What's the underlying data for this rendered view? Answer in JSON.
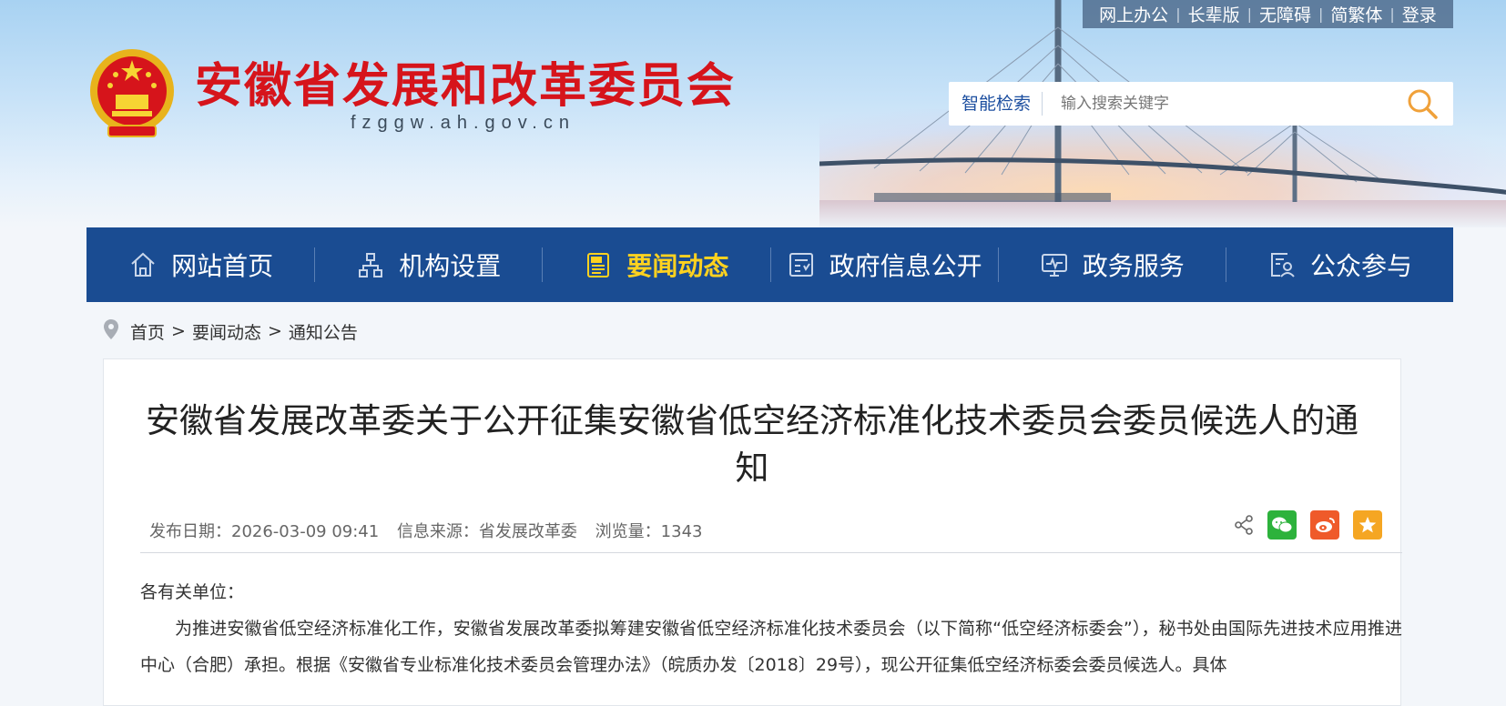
{
  "header": {
    "site_name": "安徽省发展和改革委员会",
    "site_domain": "fzggw.ah.gov.cn",
    "top_links": [
      "网上办公",
      "长辈版",
      "无障碍",
      "简繁体",
      "登录"
    ],
    "search": {
      "label": "智能检索",
      "placeholder": "输入搜索关键字"
    }
  },
  "nav": {
    "items": [
      {
        "label": "网站首页",
        "icon": "home-icon"
      },
      {
        "label": "机构设置",
        "icon": "org-chart-icon"
      },
      {
        "label": "要闻动态",
        "icon": "news-icon",
        "active": true
      },
      {
        "label": "政府信息公开",
        "icon": "info-disclosure-icon"
      },
      {
        "label": "政务服务",
        "icon": "monitor-service-icon"
      },
      {
        "label": "公众参与",
        "icon": "public-participation-icon"
      }
    ]
  },
  "breadcrumb": [
    "首页",
    "要闻动态",
    "通知公告"
  ],
  "article": {
    "title": "安徽省发展改革委关于公开征集安徽省低空经济标准化技术委员会委员候选人的通知",
    "meta": {
      "date": "发布日期：2026-03-09 09:41",
      "source": "信息来源：省发展改革委",
      "views": "浏览量：1343"
    },
    "share_icons": [
      "share-icon",
      "wechat-icon",
      "weibo-icon",
      "favorite-star-icon"
    ],
    "greeting": "各有关单位：",
    "paragraph": "为推进安徽省低空经济标准化工作，安徽省发展改革委拟筹建安徽省低空经济标准化技术委员会（以下简称“低空经济标委会”），秘书处由国际先进技术应用推进中心（合肥）承担。根据《安徽省专业标准化技术委员会管理办法》（皖质办发〔2018〕29号），现公开征集低空经济标委会委员候选人。具体"
  },
  "colors": {
    "nav_bg": "#1a4c92",
    "nav_active": "#ffd21f",
    "site_name": "#d6141b",
    "wechat": "#2db23c",
    "weibo": "#ef5a2a",
    "favorite": "#f5a623"
  }
}
